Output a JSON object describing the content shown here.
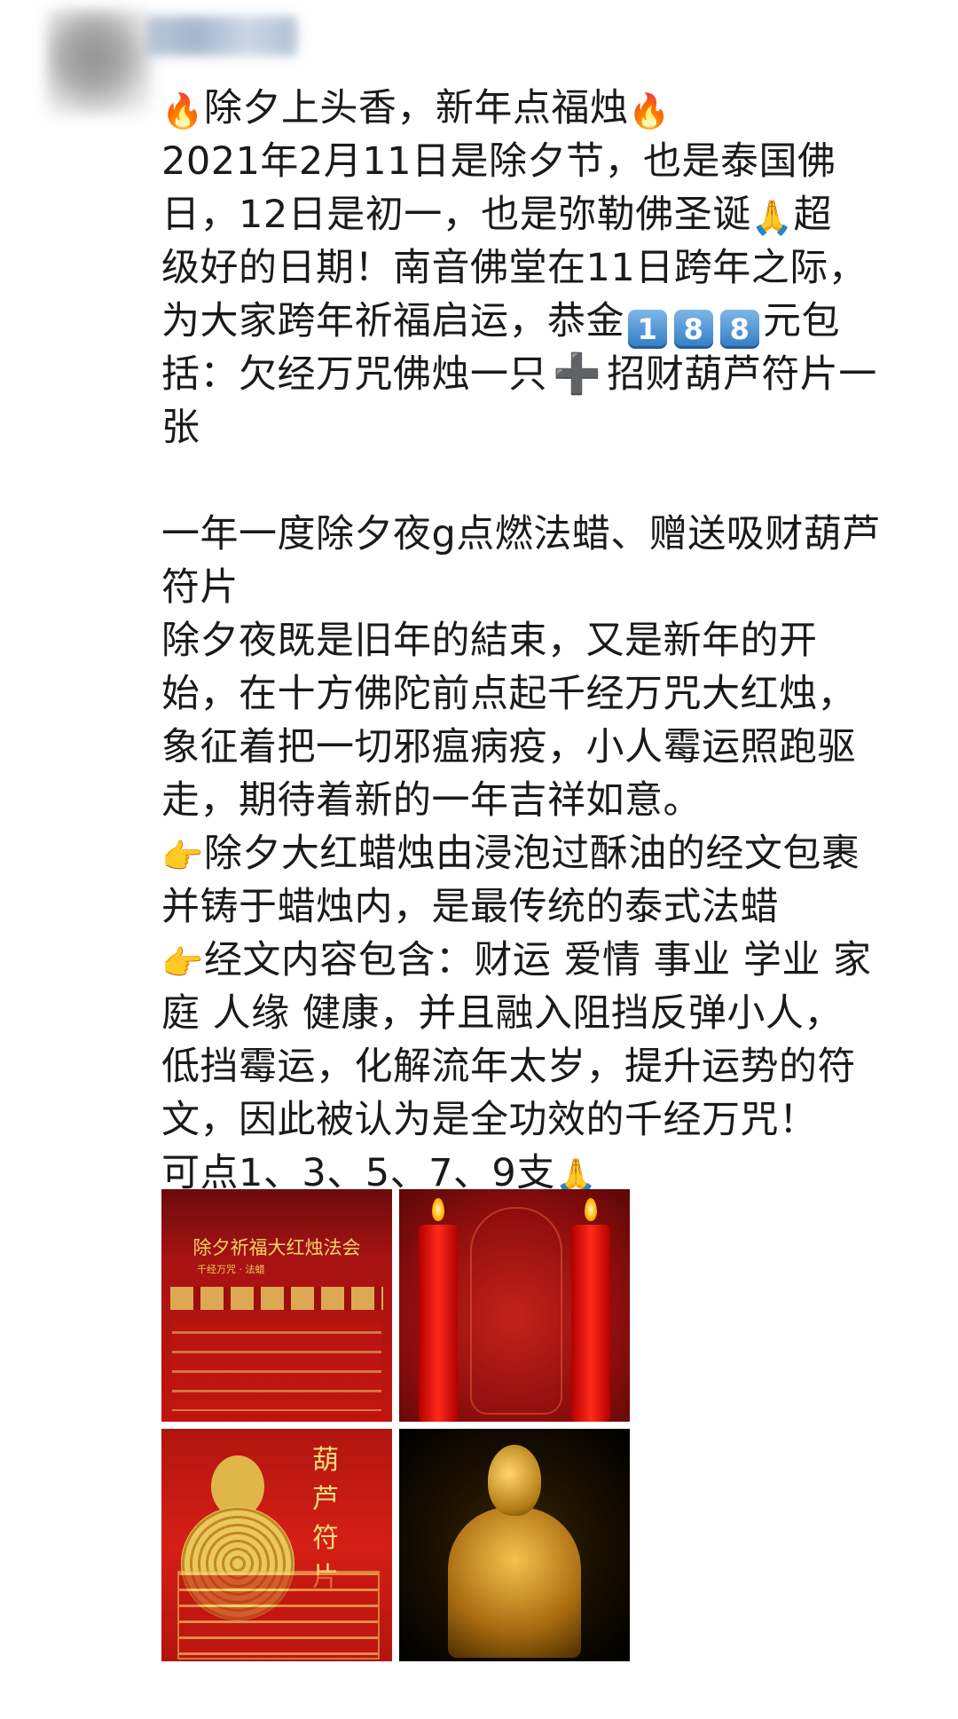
{
  "post": {
    "line1": "除夕上头香，新年点福烛",
    "line2": "2021年2月11日是除夕节，也是泰国佛",
    "line3a": "日，12日是初一，也是弥勒佛圣诞",
    "line3b": "超",
    "line4": "级好的日期！南音佛堂在11日跨年之际，",
    "line5a": "为大家跨年祈福启运，恭金",
    "line5b": "元包",
    "keycaps": [
      "1",
      "8",
      "8"
    ],
    "line6a": "括：欠经万咒佛烛一只",
    "line6b": "招财葫芦符片一",
    "line7": "张",
    "line8": "一年一度除夕夜g点燃法蜡、赠送吸财葫芦",
    "line9": "符片",
    "line10": "除夕夜既是旧年的結束，又是新年的开",
    "line11": "始，在十方佛陀前点起千经万咒大红烛，",
    "line12": "象征着把一切邪瘟病疫，小人霉运照跑驱",
    "line13": "走，期待着新的一年吉祥如意。",
    "line14": "除夕大红蜡烛由浸泡过酥油的经文包裹",
    "line15": "并铸于蜡烛内，是最传统的泰式法蜡",
    "line16": "经文内容包含：财运 爱情 事业 学业 家",
    "line17": "庭 人缘 健康，并且融入阻挡反弹小人，",
    "line18": "低挡霉运，化解流年太岁，提升运势的符",
    "line19": "文，因此被认为是全功效的千经万咒！",
    "line20": "可点1、3、5、7、9支"
  },
  "emoji": {
    "fire": "🔥",
    "pray": "🙏",
    "point": "👉",
    "plus": "➕"
  },
  "images": {
    "img1_title": "除夕祈福大红烛法会",
    "img1_subtitle": "千经万咒 · 法蜡",
    "img3_vertical": "葫芦符片"
  },
  "colors": {
    "text": "#1a1a1a",
    "keycap": "#2f7cc4",
    "red": "#c1150f",
    "gold": "#e0b64a"
  }
}
